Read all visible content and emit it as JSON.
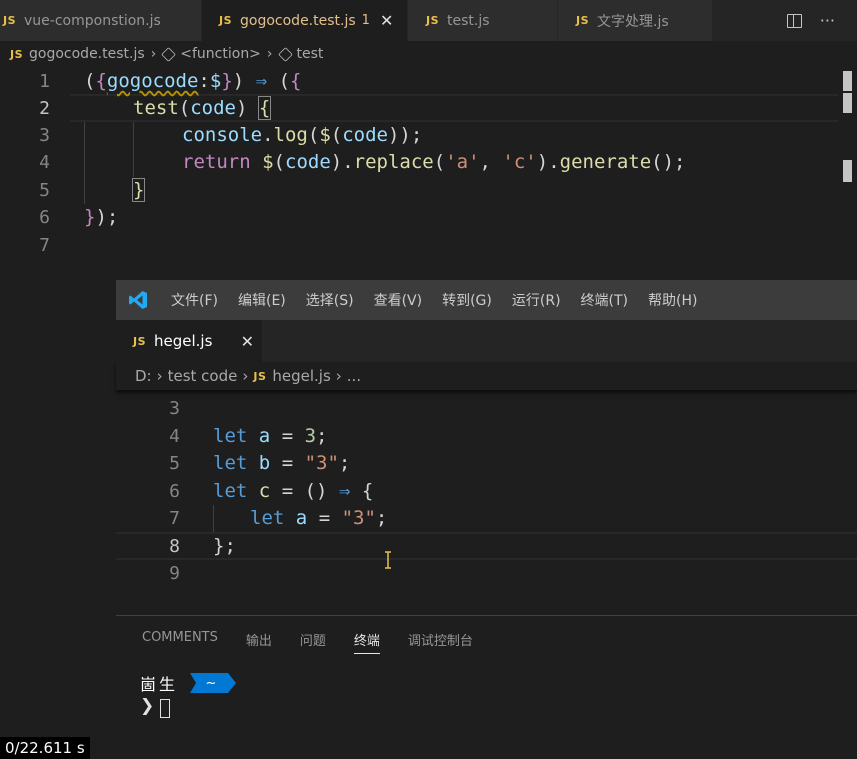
{
  "outer": {
    "tabs": [
      {
        "badge": "JS",
        "label": "vue-componstion.js"
      },
      {
        "badge": "JS",
        "label": "gogocode.test.js",
        "dirty": "1"
      },
      {
        "badge": "JS",
        "label": "test.js"
      },
      {
        "badge": "JS",
        "label": "文字处理.js"
      }
    ],
    "breadcrumb": [
      "gogocode.test.js",
      "<function>",
      "test"
    ],
    "line_numbers": [
      "1",
      "2",
      "3",
      "4",
      "5",
      "6",
      "7"
    ]
  },
  "inner": {
    "menu": [
      "文件(F)",
      "编辑(E)",
      "选择(S)",
      "查看(V)",
      "转到(G)",
      "运行(R)",
      "终端(T)",
      "帮助(H)"
    ],
    "tab": {
      "badge": "JS",
      "label": "hegel.js"
    },
    "breadcrumb": [
      "D:",
      "test code",
      "hegel.js",
      "..."
    ],
    "line_numbers": [
      "3",
      "4",
      "5",
      "6",
      "7",
      "8",
      "9"
    ]
  },
  "panel": {
    "tabs": [
      "COMMENTS",
      "输出",
      "问题",
      "终端",
      "调试控制台"
    ],
    "active_tab": "终端",
    "prompt_user": "崮生",
    "prompt_path": "~",
    "prompt_symbol": "❯"
  },
  "timer": "0/22.611 s",
  "colors": {
    "accent": "#0078d4",
    "js_badge": "#e8c04a",
    "keyword": "#c586c0",
    "function": "#dcdcaa"
  }
}
